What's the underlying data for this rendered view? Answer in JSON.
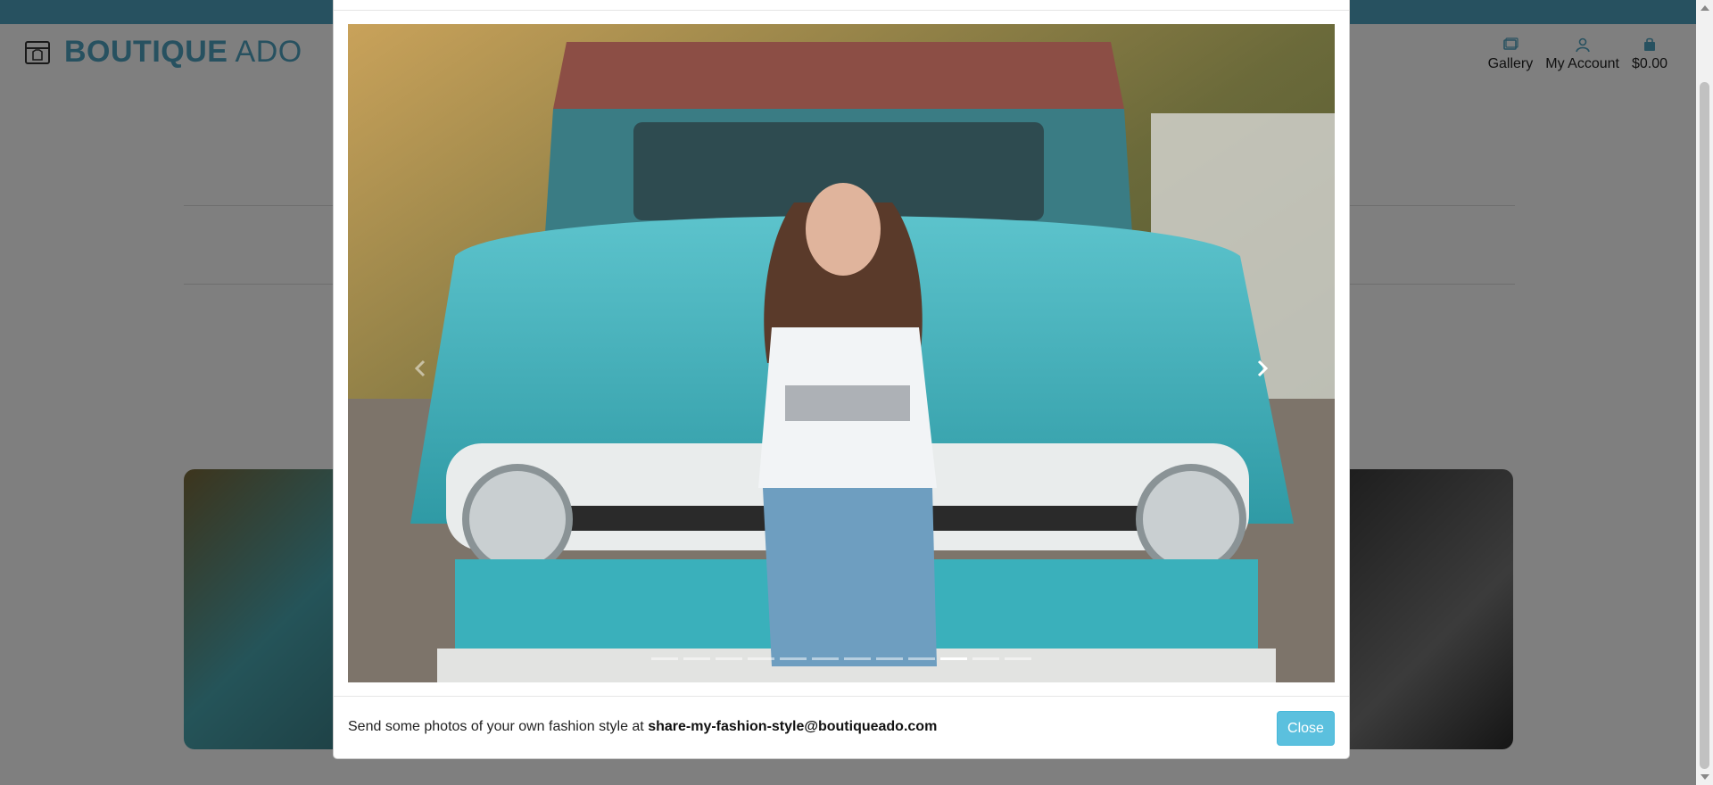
{
  "brand": {
    "bold": "BOUTIQUE",
    "light": "ADO",
    "icon": "shop-icon"
  },
  "nav": [
    {
      "label": "Gallery",
      "icon": "images-icon"
    },
    {
      "label": "My Account",
      "icon": "user-icon"
    },
    {
      "label": "$0.00",
      "icon": "shopping-bag-icon"
    }
  ],
  "modal": {
    "footer": {
      "text": "Send some photos of your own fashion style at",
      "email": "share-my-fashion-style@boutiqueado.com",
      "close_label": "Close"
    },
    "carousel": {
      "slide_count": 12,
      "active_index": 9,
      "prev_icon": "chevron-left-icon",
      "next_icon": "chevron-right-icon"
    }
  },
  "colors": {
    "brand": "#4fa3c1",
    "close_button": "#5bc0de",
    "topbar": "#4fa3c1"
  }
}
